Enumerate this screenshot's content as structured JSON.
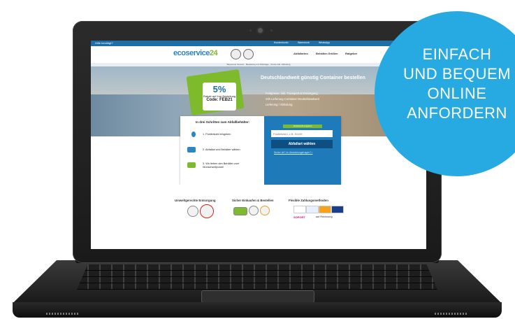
{
  "website": {
    "topbar_left": "Hilfe benötigt?",
    "topbar_links": [
      "Kundenkonto",
      "Warenkorb",
      "WhatsApp"
    ],
    "logo_main": "ecoservice",
    "logo_num": "24",
    "nav": [
      "Abfallarten",
      "Behälter-Größen",
      "Ratgeber"
    ],
    "info_strip": "Bequemer Service · Bestellung 3-4 Werktage · Preise inkl. Abholung",
    "promo_percent": "5%",
    "promo_text": "Rabatt auf Ihre Bestellung",
    "promo_code": "Code: FEB21",
    "hero_title": "Deutschlandweit günstig Container bestellen",
    "hero_bullets": [
      "Festpreise: inkl. Transport & Entsorgung",
      "24h Lieferung Container Deutschlandweit",
      "Lieferung / Abholung"
    ],
    "steps_title": "In drei Schritten zum Abfallbehälter:",
    "steps": [
      "1. Postleitzahl eingeben",
      "2. Abfallart und Behälter wählen",
      "3. Wir liefern den Behälter zum Wunschzeitpunkt!"
    ],
    "zip_label": "Postleitzahl eingeben",
    "zip_placeholder": "Postleitzahl, z.B. 51149",
    "zip_button": "Abfallart wählen",
    "help_link": "Sicher ist? Im Abwicklungsfragen? ›",
    "footer_cols": [
      "Umweltgerechte Entsorgung",
      "Sicher Einkaufen & Bestellen",
      "Flexible Zahlungsmethoden"
    ],
    "payment_extra": [
      "SOFORT",
      "auf Rechnung"
    ]
  },
  "bubble": {
    "lines": [
      "EINFACH",
      "UND BEQUEM",
      "ONLINE",
      "ANFORDERN"
    ]
  }
}
